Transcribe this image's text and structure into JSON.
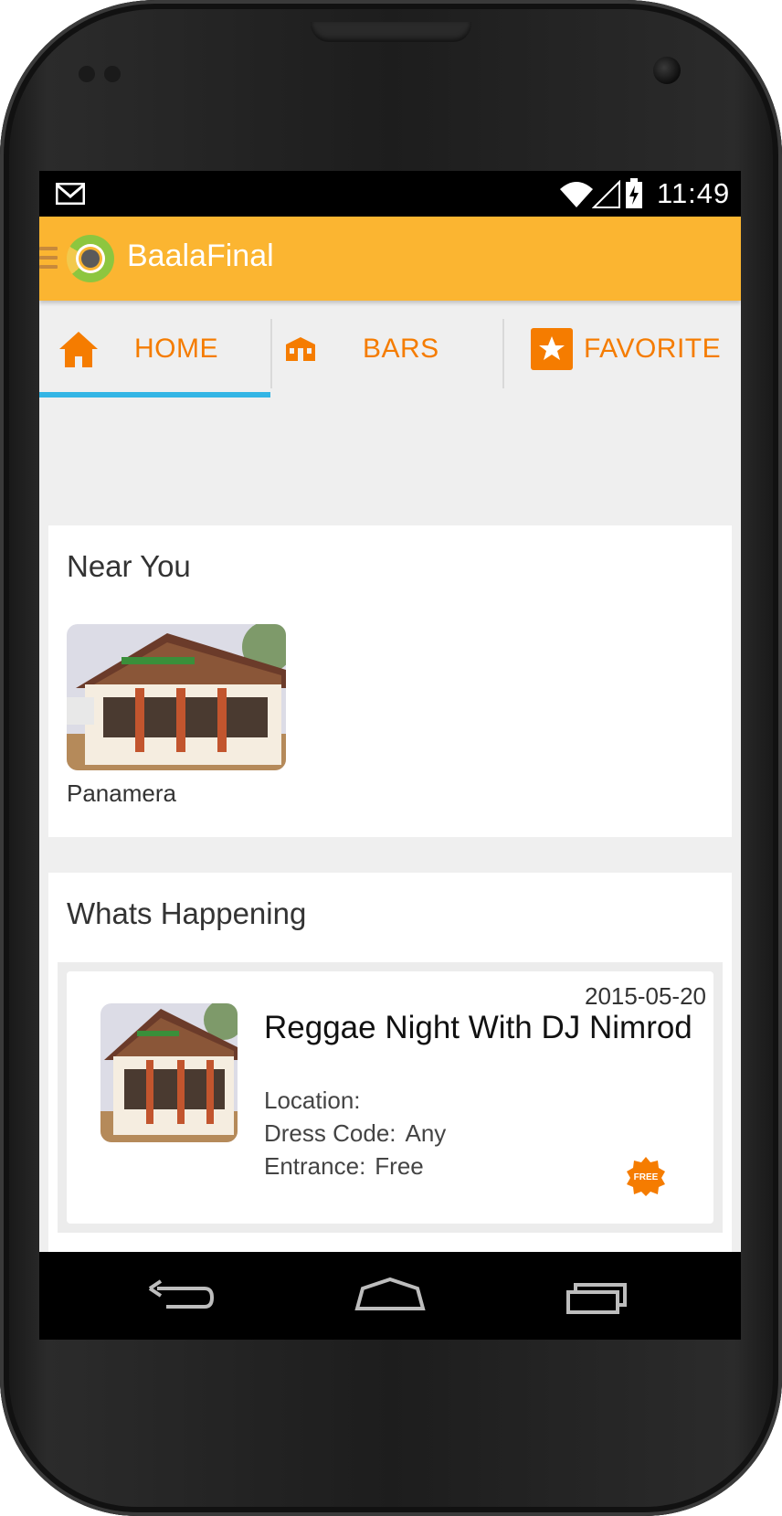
{
  "status_bar": {
    "time": "11:49",
    "icons": [
      "gmail-icon",
      "wifi-icon",
      "signal-icon",
      "battery-charging-icon"
    ]
  },
  "app_bar": {
    "title": "BaalaFinal",
    "background_color": "#fbb531"
  },
  "tabs": [
    {
      "label": "HOME",
      "icon": "home-icon",
      "selected": true
    },
    {
      "label": "BARS",
      "icon": "bar-building-icon",
      "selected": false
    },
    {
      "label": "FAVORITE",
      "icon": "star-icon",
      "selected": false
    }
  ],
  "colors": {
    "accent": "#f57c00",
    "tab_indicator": "#33b5e5",
    "background": "#efefef"
  },
  "near_you": {
    "title": "Near You",
    "items": [
      {
        "name": "Panamera",
        "image": "bar-photo"
      }
    ]
  },
  "whats_happening": {
    "title": "Whats Happening",
    "events": [
      {
        "date": "2015-05-20",
        "title": "Reggae Night With DJ Nimrod",
        "location_label": "Location:",
        "location_value": "",
        "dress_code_label": "Dress Code:",
        "dress_code_value": "Any",
        "entrance_label": "Entrance:",
        "entrance_value": "Free",
        "badge": "FREE"
      }
    ]
  },
  "nav_bar": {
    "buttons": [
      "back-icon",
      "home-icon",
      "recents-icon"
    ]
  }
}
